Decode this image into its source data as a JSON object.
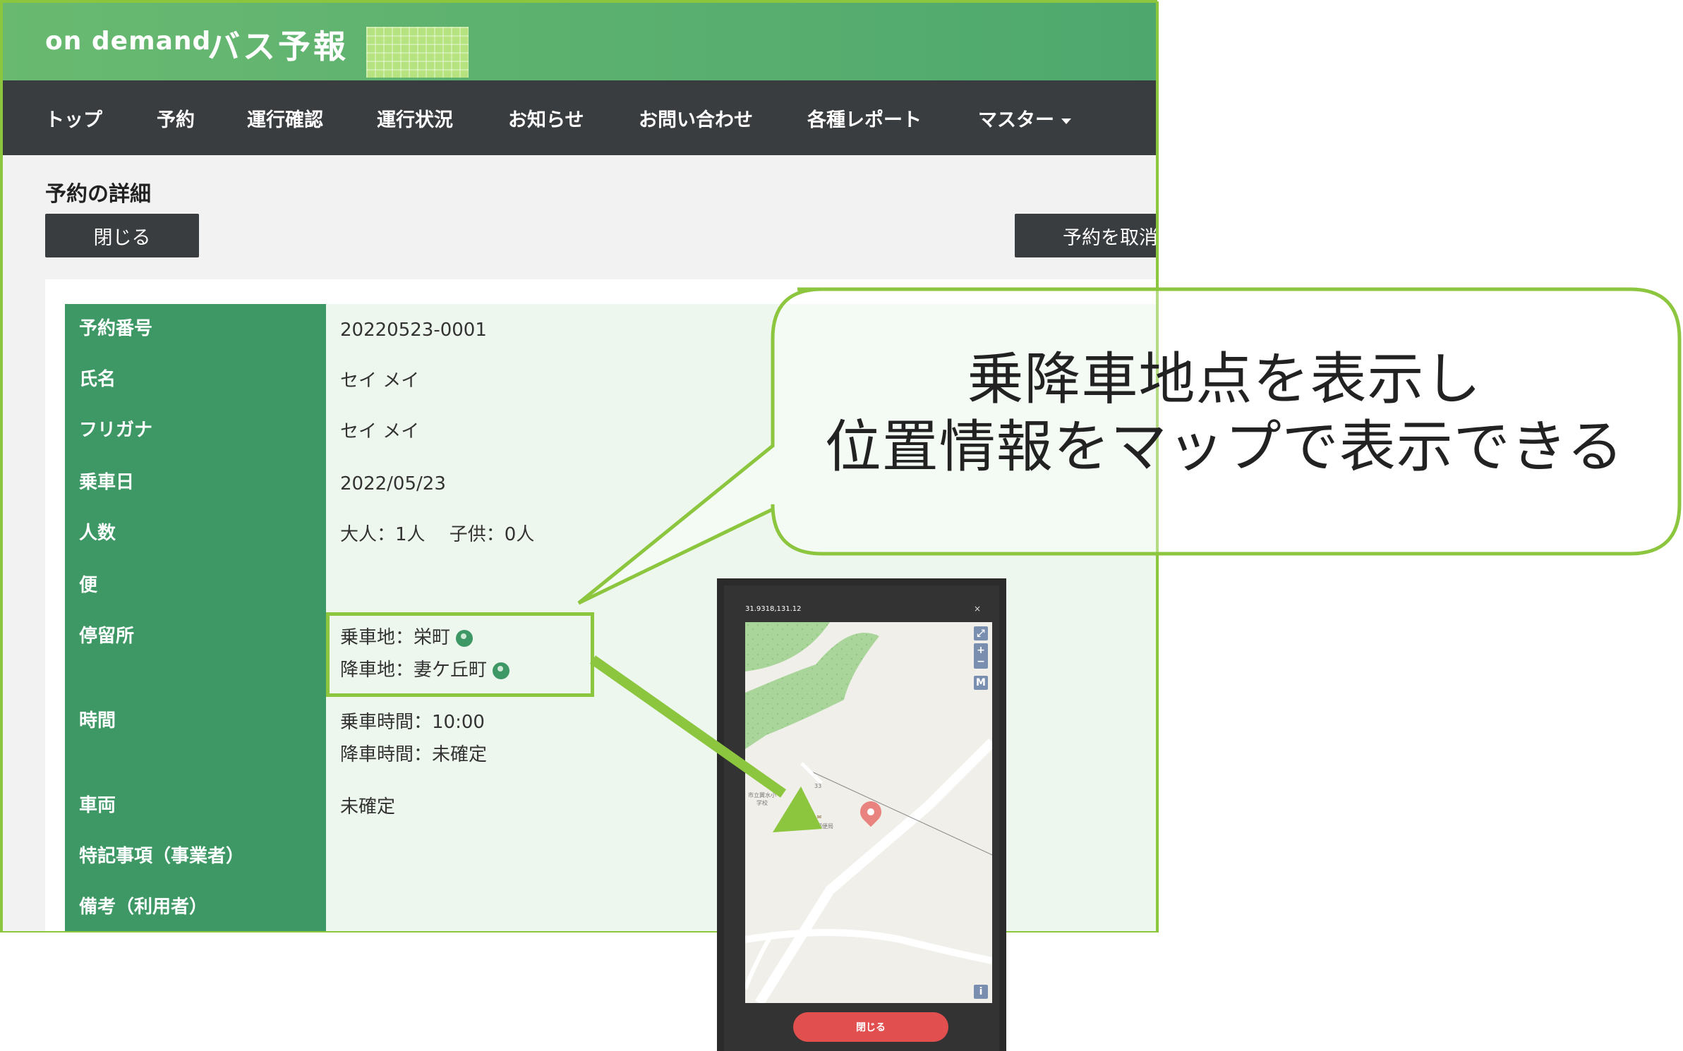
{
  "app": {
    "logo_on": "on demand",
    "logo_bus": "バス予報"
  },
  "nav": {
    "items": [
      "トップ",
      "予約",
      "運行確認",
      "運行状況",
      "お知らせ",
      "お問い合わせ",
      "各種レポート",
      "マスター"
    ]
  },
  "page": {
    "title": "予約の詳細",
    "close_button": "閉じる",
    "cancel_button": "予約を取消"
  },
  "details": {
    "rows": [
      {
        "label": "予約番号",
        "values": [
          "20220523-0001"
        ]
      },
      {
        "label": "氏名",
        "values": [
          "セイ メイ"
        ]
      },
      {
        "label": "フリガナ",
        "values": [
          "セイ メイ"
        ]
      },
      {
        "label": "乗車日",
        "values": [
          "2022/05/23"
        ]
      },
      {
        "label": "人数",
        "values": [
          "大人：1人　 子供：0人"
        ]
      },
      {
        "label": "便",
        "values": []
      },
      {
        "label": "停留所",
        "values": [
          "乗車地：栄町",
          "降車地：妻ケ丘町"
        ]
      },
      {
        "label": "時間",
        "values": [
          "乗車時間：10:00",
          "降車時間：未確定"
        ]
      },
      {
        "label": "車両",
        "values": [
          "未確定"
        ]
      },
      {
        "label": "特記事項（事業者）",
        "values": []
      },
      {
        "label": "備考（利用者）",
        "values": []
      }
    ]
  },
  "map_popup": {
    "coordinates": "31.9318,131.12",
    "close_icon_label": "×",
    "zoom_in": "+",
    "zoom_out": "−",
    "map_type": "M",
    "info": "i",
    "school_label": "市立翼水小学校",
    "post_office_label": "翼水郵便局",
    "road_number": "33",
    "close_button": "閉じる"
  },
  "callout": {
    "line1": "乗降車地点を表示し",
    "line2": "位置情報をマップで表示できる"
  },
  "colors": {
    "header_green": "#4ea86e",
    "nav_dark": "#3a3d40",
    "label_green": "#3d9865",
    "value_bg": "#eef7ee",
    "highlight_green": "#8cc63f",
    "popup_button": "#e24f4f"
  }
}
